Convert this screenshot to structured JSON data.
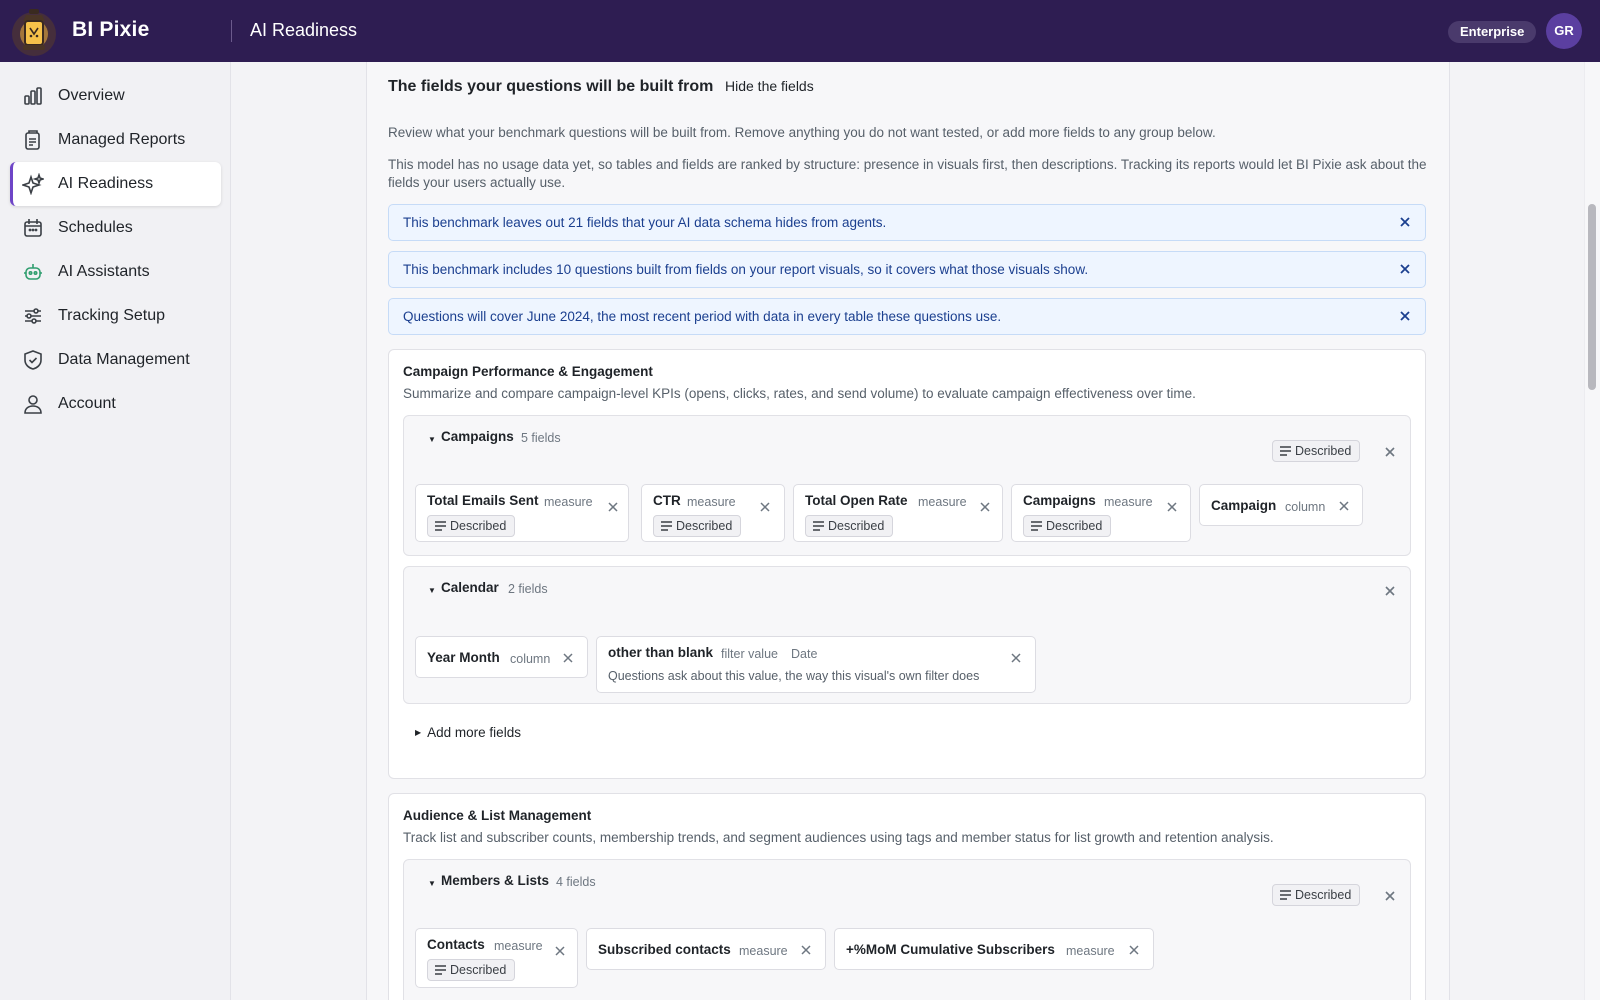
{
  "app": {
    "brand": "BI Pixie",
    "page_title": "AI Readiness",
    "plan": "Enterprise",
    "avatar_initials": "GR",
    "accent_color": "#6e45c7",
    "header_color": "#2e1d52"
  },
  "sidebar": {
    "items": [
      {
        "label": "Overview",
        "icon": "bar-chart-icon"
      },
      {
        "label": "Managed Reports",
        "icon": "reports-icon"
      },
      {
        "label": "AI Readiness",
        "icon": "sparkles-icon",
        "active": true
      },
      {
        "label": "Schedules",
        "icon": "calendar-icon"
      },
      {
        "label": "AI Assistants",
        "icon": "robot-icon"
      },
      {
        "label": "Tracking Setup",
        "icon": "sliders-icon"
      },
      {
        "label": "Data Management",
        "icon": "shield-icon"
      },
      {
        "label": "Account",
        "icon": "user-icon"
      }
    ]
  },
  "fields_section": {
    "title": "The fields your questions will be built from",
    "hide_label": "Hide the fields",
    "description": "Review what your benchmark questions will be built from. Remove anything you do not want tested, or add more fields to any group below.",
    "usage_note": "This model has no usage data yet, so tables and fields are ranked by structure: presence in visuals first, then descriptions. Tracking its reports would let BI Pixie ask about the fields your users actually use.",
    "notices": [
      "This benchmark leaves out 21 fields that your AI data schema hides from agents.",
      "This benchmark includes 10 questions built from fields on your report visuals, so it covers what those visuals show.",
      "Questions will cover June 2024, the most recent period with data in every table these questions use."
    ]
  },
  "groups": [
    {
      "title": "Campaign Performance & Engagement",
      "description": "Summarize and compare campaign-level KPIs (opens, clicks, rates, and send volume) to evaluate campaign effectiveness over time.",
      "tables": [
        {
          "name": "Campaigns",
          "count": "5 fields",
          "badge": "Described",
          "fields": [
            {
              "name": "Total Emails Sent",
              "kind": "measure",
              "badge": "Described"
            },
            {
              "name": "CTR",
              "kind": "measure",
              "badge": "Described"
            },
            {
              "name": "Total Open Rate",
              "kind": "measure",
              "badge": "Described"
            },
            {
              "name": "Campaigns",
              "kind": "measure",
              "badge": "Described"
            },
            {
              "name": "Campaign",
              "kind": "column"
            }
          ]
        },
        {
          "name": "Calendar",
          "count": "2 fields",
          "fields": [
            {
              "name": "Year Month",
              "kind": "column"
            },
            {
              "name": "other than blank",
              "kind": "filter value",
              "type": "Date",
              "note": "Questions ask about this value, the way this visual's own filter does"
            }
          ]
        }
      ],
      "add_more_label": "Add more fields"
    },
    {
      "title": "Audience & List Management",
      "description": "Track list and subscriber counts, membership trends, and segment audiences using tags and member status for list growth and retention analysis.",
      "tables": [
        {
          "name": "Members & Lists",
          "count": "4 fields",
          "badge": "Described",
          "fields": [
            {
              "name": "Contacts",
              "kind": "measure",
              "badge": "Described"
            },
            {
              "name": "Subscribed contacts",
              "kind": "measure"
            },
            {
              "name": "+%MoM Cumulative Subscribers",
              "kind": "measure"
            }
          ]
        }
      ]
    }
  ]
}
